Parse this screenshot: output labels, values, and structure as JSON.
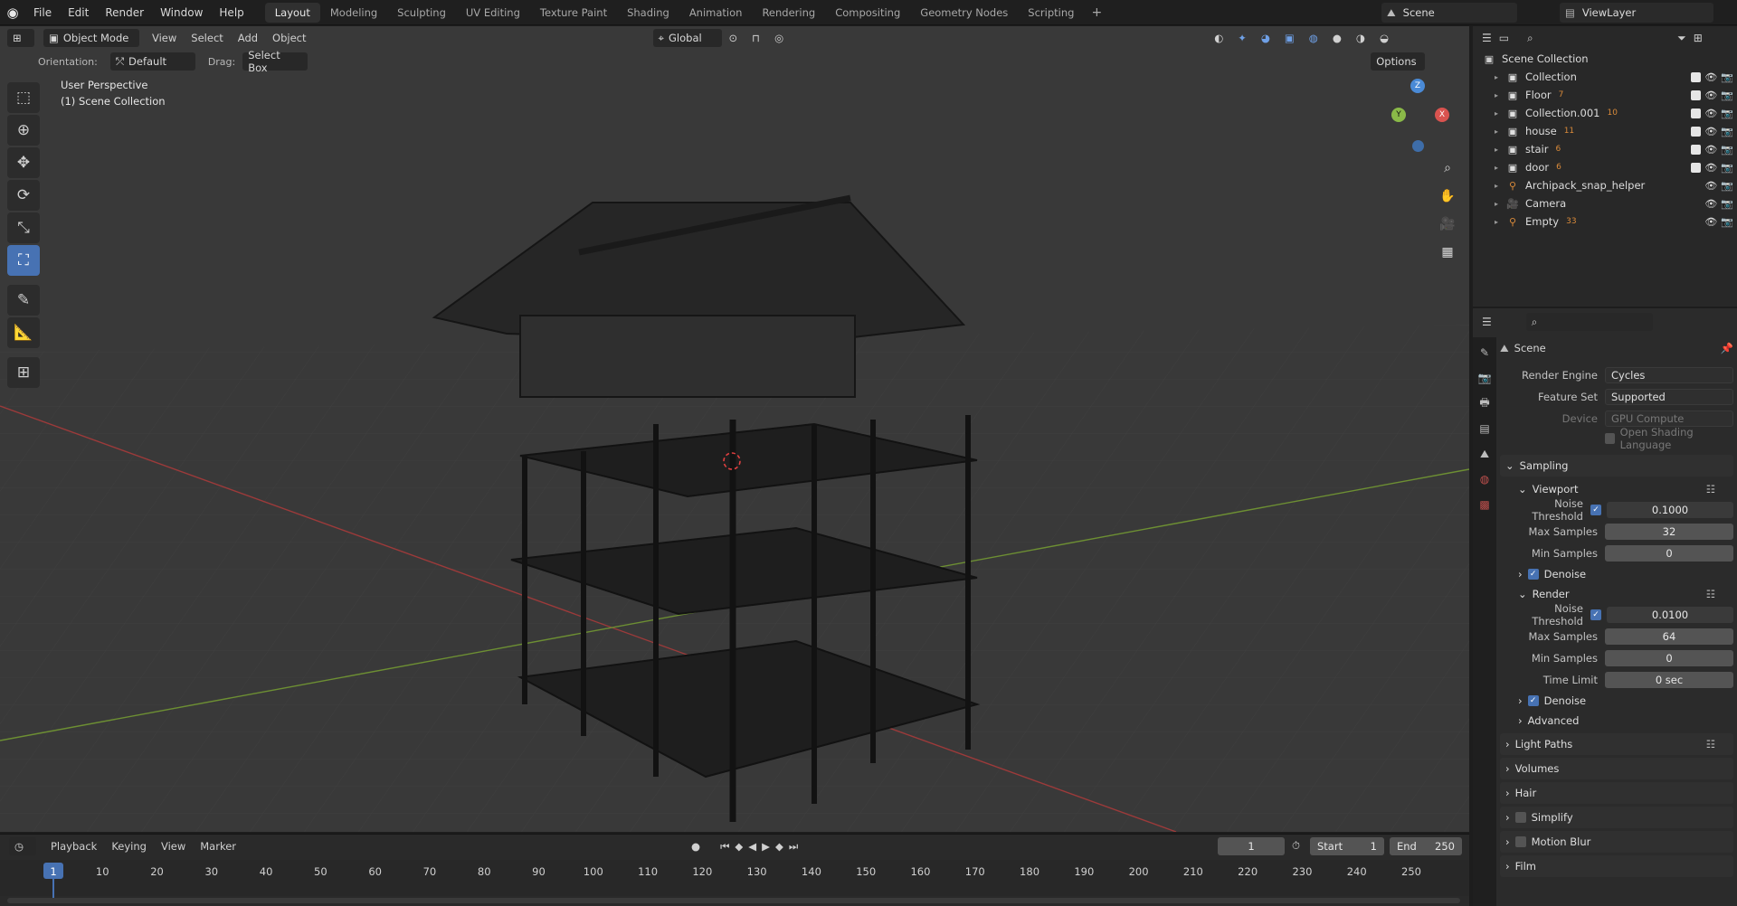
{
  "topbar": {
    "logo_icon": "blender-logo-icon",
    "menus": [
      "File",
      "Edit",
      "Render",
      "Window",
      "Help"
    ],
    "workspaces": [
      "Layout",
      "Modeling",
      "Sculpting",
      "UV Editing",
      "Texture Paint",
      "Shading",
      "Animation",
      "Rendering",
      "Compositing",
      "Geometry Nodes",
      "Scripting"
    ],
    "active_workspace": "Layout",
    "plus": "+",
    "scene": "Scene",
    "view_layer": "ViewLayer"
  },
  "viewport": {
    "mode": "Object Mode",
    "menus": [
      "View",
      "Select",
      "Add",
      "Object"
    ],
    "transform": "Global",
    "orientation_label": "Orientation:",
    "orientation_value": "Default",
    "drag_label": "Drag:",
    "drag_value": "Select Box",
    "options": "Options",
    "perspective": "User Perspective",
    "collection": "(1) Scene Collection",
    "gizmo": {
      "z": "Z",
      "y": "Y",
      "x": "X"
    }
  },
  "tools": [
    "select-box-icon",
    "cursor-icon",
    "move-icon",
    "rotate-icon",
    "scale-icon",
    "transform-icon",
    "annotate-icon",
    "measure-icon",
    "add-cube-icon"
  ],
  "outliner": {
    "root": "Scene Collection",
    "items": [
      {
        "label": "Collection",
        "badge": ""
      },
      {
        "label": "Floor",
        "badge": "7"
      },
      {
        "label": "Collection.001",
        "badge": "10"
      },
      {
        "label": "house",
        "badge": "11"
      },
      {
        "label": "stair",
        "badge": "6"
      },
      {
        "label": "door",
        "badge": "6"
      },
      {
        "label": "Archipack_snap_helper",
        "badge": ""
      },
      {
        "label": "Camera",
        "badge": ""
      },
      {
        "label": "Empty",
        "badge": "33"
      }
    ]
  },
  "properties": {
    "context": "Scene",
    "render_engine_label": "Render Engine",
    "render_engine": "Cycles",
    "feature_set_label": "Feature Set",
    "feature_set": "Supported",
    "device_label": "Device",
    "device": "GPU Compute",
    "osl": "Open Shading Language",
    "sampling": "Sampling",
    "viewport": "Viewport",
    "noise_threshold_label": "Noise Threshold",
    "vp_noise_threshold": "0.1000",
    "max_samples_label": "Max Samples",
    "vp_max_samples": "32",
    "min_samples_label": "Min Samples",
    "vp_min_samples": "0",
    "denoise": "Denoise",
    "render": "Render",
    "r_noise_threshold": "0.0100",
    "r_max_samples": "64",
    "r_min_samples": "0",
    "time_limit_label": "Time Limit",
    "r_time_limit": "0 sec",
    "advanced": "Advanced",
    "light_paths": "Light Paths",
    "volumes": "Volumes",
    "hair": "Hair",
    "simplify": "Simplify",
    "motion_blur": "Motion Blur",
    "film": "Film"
  },
  "timeline": {
    "menus": [
      "Playback",
      "Keying",
      "View",
      "Marker"
    ],
    "current_frame": "1",
    "start_label": "Start",
    "start": "1",
    "end_label": "End",
    "end": "250",
    "ticks": [
      "1",
      "10",
      "20",
      "30",
      "40",
      "50",
      "60",
      "70",
      "80",
      "90",
      "100",
      "110",
      "120",
      "130",
      "140",
      "150",
      "160",
      "170",
      "180",
      "190",
      "200",
      "210",
      "220",
      "230",
      "240",
      "250"
    ]
  },
  "colors": {
    "accent": "#4772b3",
    "x_axis": "#d9534f",
    "y_axis": "#8ab948",
    "z_axis": "#4a8ad6"
  }
}
